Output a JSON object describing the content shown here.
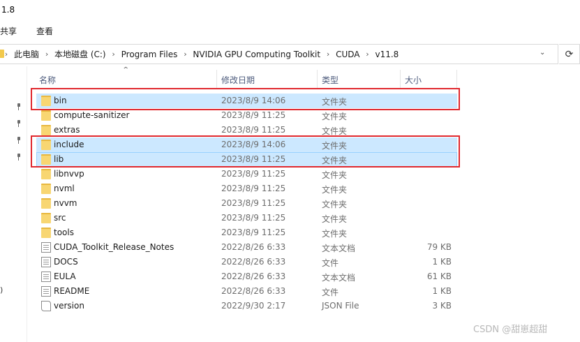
{
  "window": {
    "title": "1.8"
  },
  "menu": {
    "share": "共享",
    "view": "查看"
  },
  "address": {
    "crumbs": [
      "此电脑",
      "本地磁盘 (C:)",
      "Program Files",
      "NVIDIA GPU Computing Toolkit",
      "CUDA",
      "v11.8"
    ],
    "separator": "›",
    "dropdown_icon": "chevron-down-icon",
    "refresh_icon": "refresh-icon"
  },
  "nav": {
    "partial_text": ")"
  },
  "columns": {
    "name": "名称",
    "modified": "修改日期",
    "type": "类型",
    "size": "大小"
  },
  "files": [
    {
      "name": "bin",
      "modified": "2023/8/9 14:06",
      "type": "文件夹",
      "size": "",
      "icon": "folder-icon",
      "selected": true
    },
    {
      "name": "compute-sanitizer",
      "modified": "2023/8/9 11:25",
      "type": "文件夹",
      "size": "",
      "icon": "folder-icon",
      "selected": false
    },
    {
      "name": "extras",
      "modified": "2023/8/9 11:25",
      "type": "文件夹",
      "size": "",
      "icon": "folder-icon",
      "selected": false
    },
    {
      "name": "include",
      "modified": "2023/8/9 14:06",
      "type": "文件夹",
      "size": "",
      "icon": "folder-icon",
      "selected": true
    },
    {
      "name": "lib",
      "modified": "2023/8/9 11:25",
      "type": "文件夹",
      "size": "",
      "icon": "folder-icon",
      "selected": true
    },
    {
      "name": "libnvvp",
      "modified": "2023/8/9 11:25",
      "type": "文件夹",
      "size": "",
      "icon": "folder-icon",
      "selected": false
    },
    {
      "name": "nvml",
      "modified": "2023/8/9 11:25",
      "type": "文件夹",
      "size": "",
      "icon": "folder-icon",
      "selected": false
    },
    {
      "name": "nvvm",
      "modified": "2023/8/9 11:25",
      "type": "文件夹",
      "size": "",
      "icon": "folder-icon",
      "selected": false
    },
    {
      "name": "src",
      "modified": "2023/8/9 11:25",
      "type": "文件夹",
      "size": "",
      "icon": "folder-icon",
      "selected": false
    },
    {
      "name": "tools",
      "modified": "2023/8/9 11:25",
      "type": "文件夹",
      "size": "",
      "icon": "folder-icon",
      "selected": false
    },
    {
      "name": "CUDA_Toolkit_Release_Notes",
      "modified": "2022/8/26 6:33",
      "type": "文本文档",
      "size": "79 KB",
      "icon": "text-document-icon",
      "selected": false
    },
    {
      "name": "DOCS",
      "modified": "2022/8/26 6:33",
      "type": "文件",
      "size": "1 KB",
      "icon": "file-icon",
      "selected": false
    },
    {
      "name": "EULA",
      "modified": "2022/8/26 6:33",
      "type": "文本文档",
      "size": "61 KB",
      "icon": "text-document-icon",
      "selected": false
    },
    {
      "name": "README",
      "modified": "2022/8/26 6:33",
      "type": "文件",
      "size": "1 KB",
      "icon": "file-icon",
      "selected": false
    },
    {
      "name": "version",
      "modified": "2022/9/30 2:17",
      "type": "JSON File",
      "size": "3 KB",
      "icon": "json-file-icon",
      "selected": false
    }
  ],
  "colors": {
    "selection": "#cce8ff",
    "highlight_box": "#e0282e",
    "header_text": "#4d5b7c"
  },
  "watermark": "CSDN @甜崽超甜"
}
